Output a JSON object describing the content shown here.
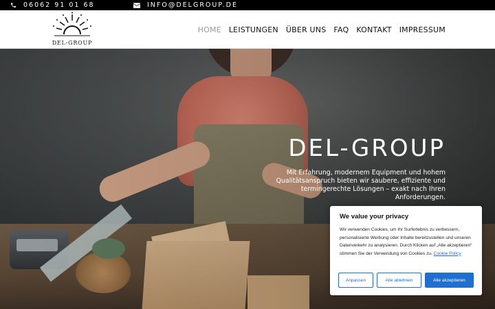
{
  "topbar": {
    "phone_icon": "phone-icon",
    "phone": "06062 91 01 68",
    "mail_icon": "envelope-icon",
    "email": "INFO@DELGROUP.DE"
  },
  "header": {
    "logo_text": "DEL-GROUP",
    "nav": [
      {
        "label": "HOME"
      },
      {
        "label": "LEISTUNGEN"
      },
      {
        "label": "ÜBER UNS"
      },
      {
        "label": "FAQ"
      },
      {
        "label": "KONTAKT"
      },
      {
        "label": "IMPRESSUM"
      }
    ]
  },
  "hero": {
    "title": "DEL-GROUP",
    "text": "Mit Erfahrung, modernem Equipment und hohem Qualitätsanspruch bieten wir saubere, effiziente und termingerechte Lösungen – exakt nach Ihren Anforderungen."
  },
  "cookie": {
    "title": "We value your privacy",
    "body": "Wir verwenden Cookies, um Ihr Surferlebnis zu verbessern, personalisierte Werbung oder Inhalte bereitzustellen und unseren Datenverkehr zu analysieren. Durch Klicken auf „Alle akzeptieren“ stimmen Sie der Verwendung von Cookies zu.",
    "link": "Cookie Policy",
    "btn_customize": "Anpassen",
    "btn_reject": "Alle ablehnen",
    "btn_accept": "Alle akzeptieren"
  },
  "colors": {
    "accent": "#1f6fd1",
    "topbar": "#000000",
    "nav_active": "#9a9a9a"
  }
}
